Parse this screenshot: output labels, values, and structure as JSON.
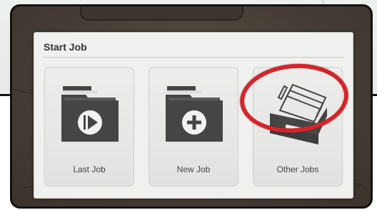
{
  "dialog": {
    "title": "Start Job",
    "options": [
      {
        "label": "Last Job",
        "icon": "play-folder-icon"
      },
      {
        "label": "New Job",
        "icon": "add-folder-icon"
      },
      {
        "label": "Other Jobs",
        "icon": "file-drawer-icon"
      }
    ]
  },
  "annotation": {
    "highlighted_option": "Other Jobs",
    "color": "#d4252b"
  },
  "colors": {
    "icon": "#454545",
    "panel": "#f0f0ef",
    "tile": "#e6e6e5"
  }
}
